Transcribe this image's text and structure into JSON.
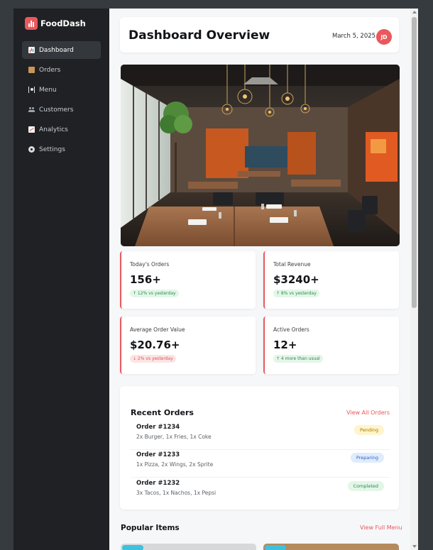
{
  "app": {
    "name": "FoodDash"
  },
  "sidebar": {
    "items": [
      {
        "label": "Dashboard",
        "icon": "dashboard-icon",
        "active": true
      },
      {
        "label": "Orders",
        "icon": "box-icon"
      },
      {
        "label": "Menu",
        "icon": "plate-icon"
      },
      {
        "label": "Customers",
        "icon": "users-icon"
      },
      {
        "label": "Analytics",
        "icon": "chart-icon"
      },
      {
        "label": "Settings",
        "icon": "gear-icon"
      }
    ]
  },
  "header": {
    "title": "Dashboard Overview",
    "date": "March 5, 2025",
    "avatar_initials": "JD"
  },
  "stats": [
    {
      "label": "Today's Orders",
      "value": "156+",
      "change": "↑ 12% vs yesterday",
      "trend": "up"
    },
    {
      "label": "Total Revenue",
      "value": "$3240+",
      "change": "↑ 8% vs yesterday",
      "trend": "up"
    },
    {
      "label": "Average Order Value",
      "value": "$20.76+",
      "change": "↓ 2% vs yesterday",
      "trend": "down"
    },
    {
      "label": "Active Orders",
      "value": "12+",
      "change": "↑ 4 more than usual",
      "trend": "up"
    }
  ],
  "recent_orders": {
    "title": "Recent Orders",
    "view_all": "View All Orders",
    "orders": [
      {
        "id": "Order #1234",
        "items": "2x Burger, 1x Fries, 1x Coke",
        "status": "Pending"
      },
      {
        "id": "Order #1233",
        "items": "1x Pizza, 2x Wings, 2x Sprite",
        "status": "Preparing"
      },
      {
        "id": "Order #1232",
        "items": "3x Tacos, 1x Nachos, 1x Pepsi",
        "status": "Completed"
      }
    ]
  },
  "popular_items": {
    "title": "Popular Items",
    "view_all": "View Full Menu"
  },
  "colors": {
    "accent": "#e8585c",
    "sidebar_bg": "#1f2124",
    "main_bg": "#f6f7f9",
    "pending": "#fff4cc",
    "preparing": "#e0ebfb",
    "completed": "#e3f6e8"
  }
}
